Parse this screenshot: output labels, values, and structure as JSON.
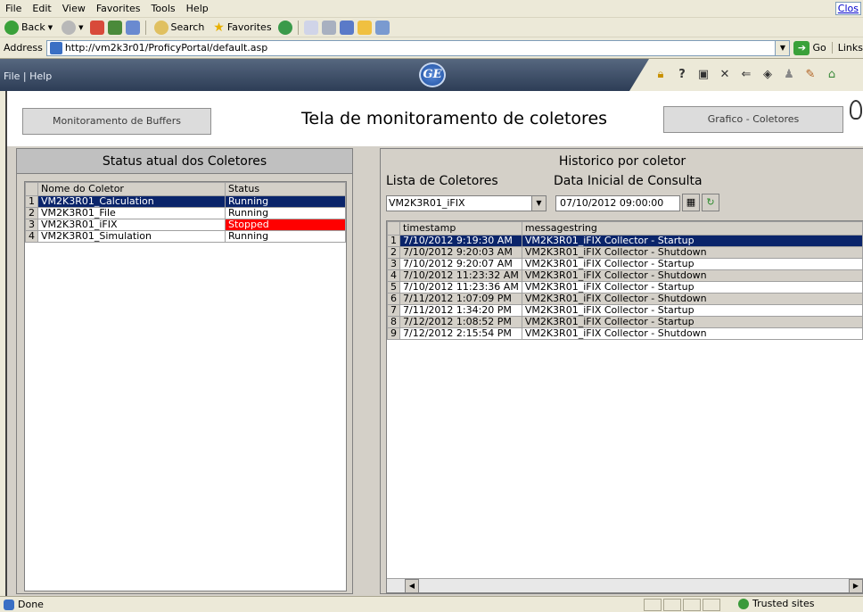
{
  "browser": {
    "menu": [
      "File",
      "Edit",
      "View",
      "Favorites",
      "Tools",
      "Help"
    ],
    "close_link": "Clos",
    "toolbar": {
      "back": "Back",
      "search": "Search",
      "favorites": "Favorites"
    },
    "address_label": "Address",
    "address_url": "http://vm2k3r01/ProficyPortal/default.asp",
    "go_label": "Go",
    "links_label": "Links"
  },
  "portal": {
    "menu": "File | Help",
    "logo_text": "GE",
    "tray_icons": [
      "lock-icon",
      "help-icon",
      "save-icon",
      "tools-icon",
      "back-icon",
      "light-icon",
      "users-icon",
      "edit-icon",
      "home-icon"
    ]
  },
  "page": {
    "buffers_button": "Monitoramento de Buffers",
    "title": "Tela de monitoramento de coletores",
    "chart_button": "Grafico - Coletores"
  },
  "status_panel": {
    "title": "Status atual dos Coletores",
    "columns": [
      "Nome do Coletor",
      "Status"
    ],
    "rows": [
      {
        "n": "1",
        "name": "VM2K3R01_Calculation",
        "status": "Running"
      },
      {
        "n": "2",
        "name": "VM2K3R01_File",
        "status": "Running"
      },
      {
        "n": "3",
        "name": "VM2K3R01_iFIX",
        "status": "Stopped"
      },
      {
        "n": "4",
        "name": "VM2K3R01_Simulation",
        "status": "Running"
      }
    ]
  },
  "history_panel": {
    "title": "Historico por coletor",
    "collector_list_label": "Lista de Coletores",
    "collector_selected": "VM2K3R01_iFIX",
    "start_date_label": "Data Inicial de Consulta",
    "start_date_value": "07/10/2012 09:00:00",
    "columns": [
      "timestamp",
      "messagestring"
    ],
    "rows": [
      {
        "n": "1",
        "timestamp": "7/10/2012 9:19:30 AM",
        "message": "VM2K3R01_iFIX Collector - Startup"
      },
      {
        "n": "2",
        "timestamp": "7/10/2012 9:20:03 AM",
        "message": "VM2K3R01_iFIX Collector - Shutdown"
      },
      {
        "n": "3",
        "timestamp": "7/10/2012 9:20:07 AM",
        "message": "VM2K3R01_iFIX Collector - Startup"
      },
      {
        "n": "4",
        "timestamp": "7/10/2012 11:23:32 AM",
        "message": "VM2K3R01_iFIX Collector - Shutdown"
      },
      {
        "n": "5",
        "timestamp": "7/10/2012 11:23:36 AM",
        "message": "VM2K3R01_iFIX Collector - Startup"
      },
      {
        "n": "6",
        "timestamp": "7/11/2012 1:07:09 PM",
        "message": "VM2K3R01_iFIX Collector - Shutdown"
      },
      {
        "n": "7",
        "timestamp": "7/11/2012 1:34:20 PM",
        "message": "VM2K3R01_iFIX Collector - Startup"
      },
      {
        "n": "8",
        "timestamp": "7/12/2012 1:08:52 PM",
        "message": "VM2K3R01_iFIX Collector - Startup"
      },
      {
        "n": "9",
        "timestamp": "7/12/2012 2:15:54 PM",
        "message": "VM2K3R01_iFIX Collector - Shutdown"
      }
    ]
  },
  "statusbar": {
    "done": "Done",
    "zone": "Trusted sites"
  }
}
